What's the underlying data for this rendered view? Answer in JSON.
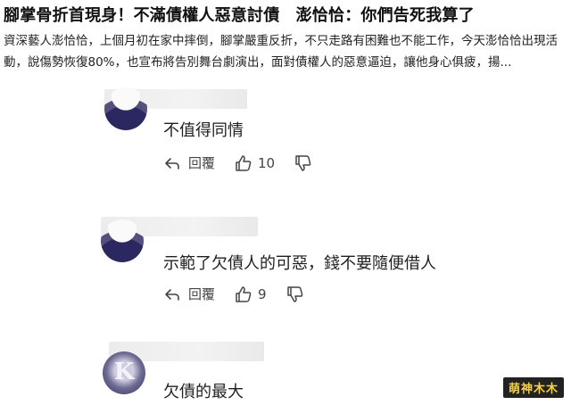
{
  "headline": "腳掌骨折首現身！不滿債權人惡意討債　澎恰恰：你們告死我算了",
  "summary": "資深藝人澎恰恰，上個月初在家中摔倒，腳掌嚴重反折，不只走路有困難也不能工作，今天澎恰恰出現活動，說傷勢恢復80%，也宣布將告別舞台劇演出，面對債權人的惡意逼迫，讓他身心俱疲，揚...",
  "comments": [
    {
      "text": "不值得同情",
      "reply_label": "回覆",
      "like_count": "10",
      "avatar_icon": "user-avatar"
    },
    {
      "text": "示範了欠債人的可惡，錢不要隨便借人",
      "reply_label": "回覆",
      "like_count": "9",
      "avatar_icon": "user-avatar"
    },
    {
      "text": "欠債的最大",
      "avatar_letter": "K",
      "avatar_icon": "user-avatar"
    }
  ],
  "watermark": "萌神木木",
  "colors": {
    "background": "#ffffff",
    "text": "#1f1f1f",
    "icon": "#444444",
    "watermark_bg": "#222222",
    "watermark_fg": "#f5d24a"
  }
}
